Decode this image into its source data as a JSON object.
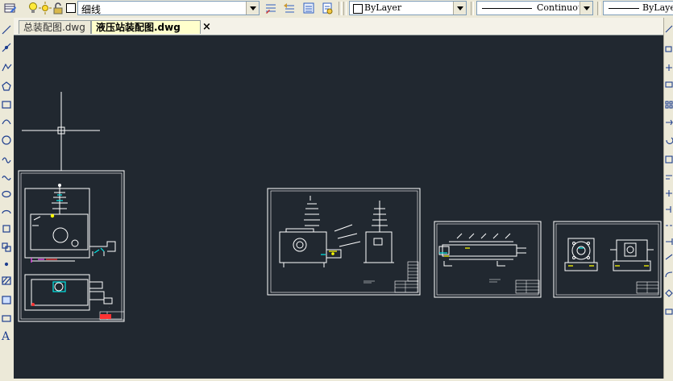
{
  "toolbar": {
    "layer_name": "细线",
    "color_value": "ByLayer",
    "linetype_value": "Continuous",
    "lineweight_value": "ByLayer"
  },
  "tabs": [
    {
      "label": "总装配图.dwg",
      "active": false
    },
    {
      "label": "液压站装配图.dwg",
      "active": true
    }
  ],
  "tab_close_glyph": "×",
  "colors": {
    "canvas_bg": "#212830",
    "chrome_bg": "#ece9d8",
    "active_tab": "#ffffcc",
    "drawing_line": "#ffffff",
    "accent_cyan": "#00e5e5",
    "accent_red": "#ff3333",
    "accent_yellow": "#ffff00",
    "accent_magenta": "#ff44ff"
  },
  "icons": [
    "layer-manager-icon",
    "bulb-on-icon",
    "sun-icon",
    "lock-icon",
    "color-square-icon",
    "dropdown-arrow-icon",
    "make-current-icon",
    "layer-previous-icon",
    "layer-states-icon",
    "match-layer-icon",
    "color-swatch-icon",
    "close-drawing-icon",
    "crosshair-cursor-icon"
  ]
}
